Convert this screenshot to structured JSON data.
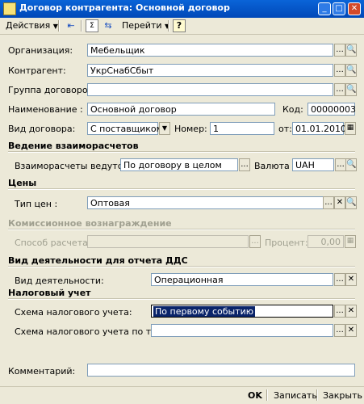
{
  "window": {
    "title": "Договор контрагента: Основной договор",
    "buttons": {
      "minimize": "_",
      "maximize": "□",
      "close": "✕"
    }
  },
  "toolbar": {
    "actions": "Действия",
    "goto": "Перейти",
    "help": "?"
  },
  "form": {
    "organization": {
      "label": "Организация:",
      "value": "Мебельщик"
    },
    "counterparty": {
      "label": "Контрагент:",
      "value": "УкрСнабСбыт"
    },
    "contract_group": {
      "label": "Группа договоров:",
      "value": ""
    },
    "name": {
      "label": "Наименование :",
      "value": "Основной договор"
    },
    "code": {
      "label": "Код:",
      "value": "00000003"
    },
    "contract_kind": {
      "label": "Вид договора:",
      "value": "С поставщиком"
    },
    "number": {
      "label": "Номер:",
      "value": "1"
    },
    "date": {
      "label": "от:",
      "value": "01.01.2010"
    }
  },
  "settlements": {
    "section": "Ведение взаиморасчетов",
    "mode": {
      "label": "Взаиморасчеты ведутся:",
      "value": "По договору в целом"
    },
    "currency": {
      "label": "Валюта :",
      "value": "UAH"
    }
  },
  "prices": {
    "section": "Цены",
    "price_type": {
      "label": "Тип цен :",
      "value": "Оптовая"
    }
  },
  "commission": {
    "section": "Комиссионное вознаграждение",
    "calc_method": {
      "label": "Способ расчета:",
      "value": ""
    },
    "percent": {
      "label": "Процент:",
      "value": "0,00"
    }
  },
  "cashflow": {
    "section": "Вид деятельности для отчета ДДС",
    "activity": {
      "label": "Вид деятельности:",
      "value": "Операционная"
    }
  },
  "tax": {
    "section": "Налоговый учет",
    "scheme": {
      "label": "Схема налогового учета:",
      "value": "По первому событию"
    },
    "scheme_tare": {
      "label": "Схема налогового учета по таре:",
      "value": ""
    }
  },
  "comment": {
    "label": "Комментарий:",
    "value": ""
  },
  "footer": {
    "ok": "OK",
    "save": "Записать",
    "close": "Закрыть"
  }
}
